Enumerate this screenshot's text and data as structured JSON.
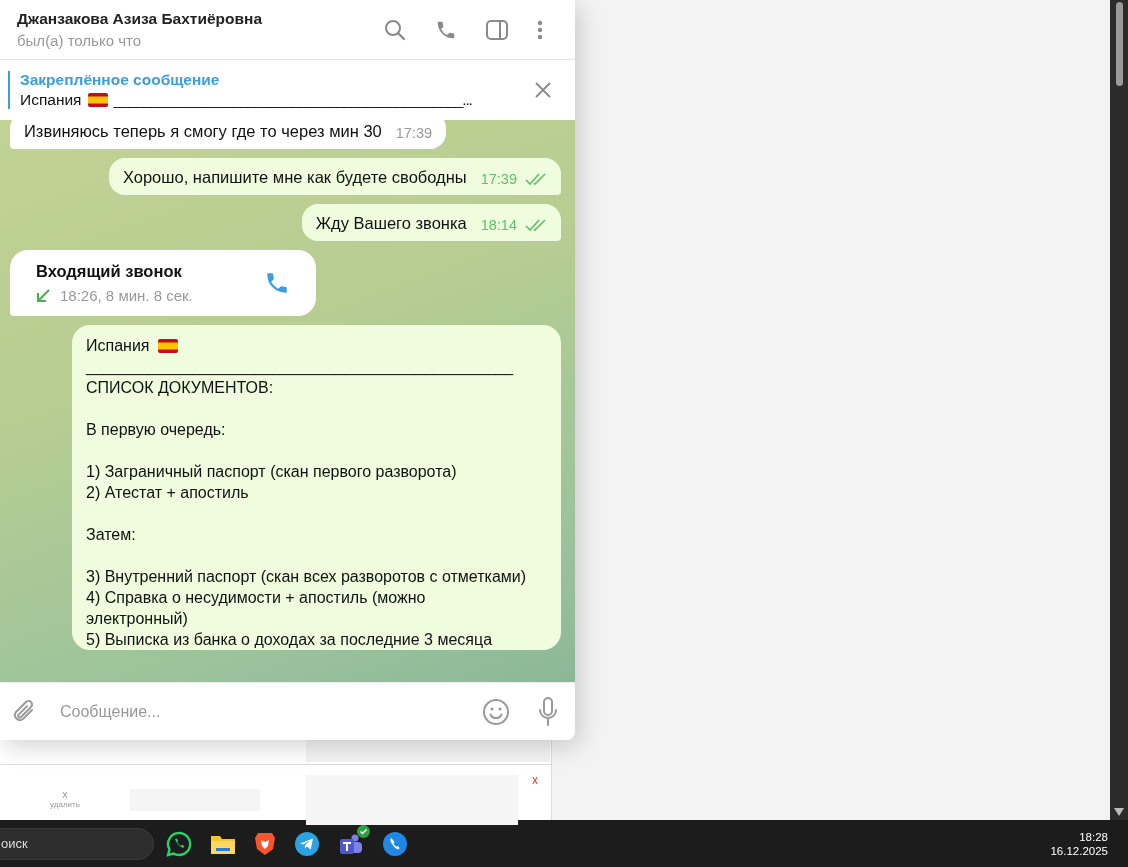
{
  "chat": {
    "title": "Джанзакова Азиза Бахтиёровна",
    "status": "был(а) только что"
  },
  "pinned": {
    "label": "Закреплённое сообщение",
    "preview": "Испания",
    "preview_tail": "_______________________________________________..."
  },
  "messages": [
    {
      "kind": "text",
      "outgoing": false,
      "text": "Извиняюсь теперь я смогу где то через мин 30",
      "time": "17:39"
    },
    {
      "kind": "text",
      "outgoing": true,
      "read": true,
      "text": "Хорошо, напишите мне как будете свободны",
      "time": "17:39"
    },
    {
      "kind": "text",
      "outgoing": true,
      "read": true,
      "text": "Жду Вашего звонка",
      "time": "18:14"
    },
    {
      "kind": "call",
      "outgoing": false,
      "title": "Входящий звонок",
      "detail": "18:26, 8 мин. 8 сек."
    },
    {
      "kind": "document",
      "outgoing": true,
      "title": "Испания",
      "paragraphs": [
        [
          "________________________________________________",
          "СПИСОК ДОКУМЕНТОВ:"
        ],
        [
          "В первую очередь:"
        ],
        [
          "1) Заграничный паспорт (скан первого разворота)",
          "2) Атестат + апостиль"
        ],
        [
          "Затем:"
        ],
        [
          "3) Внутренний паспорт (скан всех разворотов с отметками)",
          "4) Справка о несудимости + апостиль  (можно электронный)",
          "5) Выписка из банка о доходах за последние 3 месяца"
        ]
      ]
    }
  ],
  "composer": {
    "placeholder": "Сообщение..."
  },
  "background_page": {
    "delete_mark": "x",
    "close_mark": "x",
    "delete_label": "удалить"
  },
  "taskbar": {
    "search": "оиск",
    "time": "18:28",
    "date": "16.12.2025"
  }
}
